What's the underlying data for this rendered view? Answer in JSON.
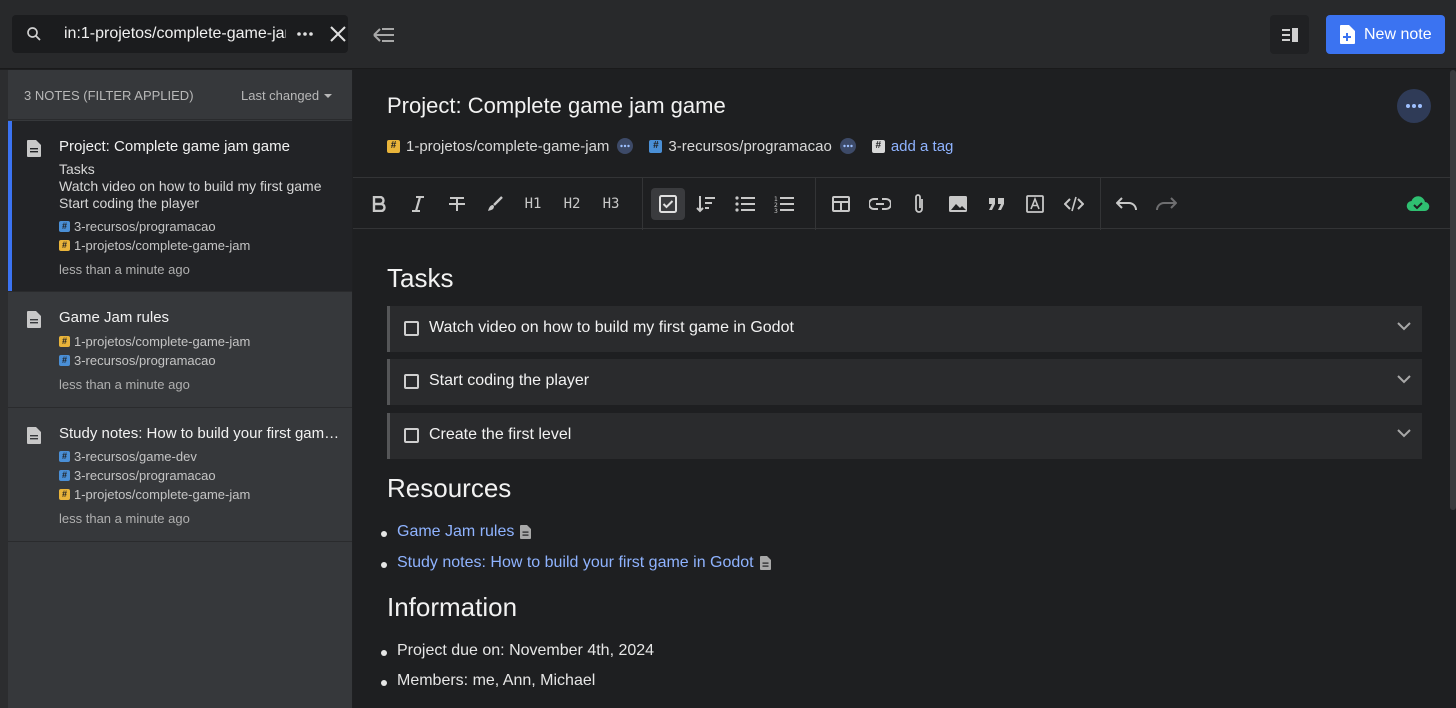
{
  "search": {
    "value": "in:1-projetos/complete-game-jam"
  },
  "header": {
    "new_note_label": "New note"
  },
  "list": {
    "count_label": "3 NOTES (FILTER APPLIED)",
    "sort_label": "Last changed",
    "notes": [
      {
        "title": "Project: Complete game jam game",
        "preview": [
          "Tasks",
          "Watch video on how to build my first game",
          "Start coding the player"
        ],
        "tags": [
          {
            "name": "3-recursos/programacao",
            "color": "#4a8fd6"
          },
          {
            "name": "1-projetos/complete-game-jam",
            "color": "#e9b43a"
          }
        ],
        "time": "less than a minute ago"
      },
      {
        "title": "Game Jam rules",
        "tags": [
          {
            "name": "1-projetos/complete-game-jam",
            "color": "#e9b43a"
          },
          {
            "name": "3-recursos/programacao",
            "color": "#4a8fd6"
          }
        ],
        "time": "less than a minute ago"
      },
      {
        "title": "Study notes: How to build your first game in Godot",
        "tags": [
          {
            "name": "3-recursos/game-dev",
            "color": "#4a8fd6"
          },
          {
            "name": "3-recursos/programacao",
            "color": "#4a8fd6"
          },
          {
            "name": "1-projetos/complete-game-jam",
            "color": "#e9b43a"
          }
        ],
        "time": "less than a minute ago"
      }
    ]
  },
  "note": {
    "title": "Project: Complete game jam game",
    "tags": [
      "1-projetos/complete-game-jam",
      "3-recursos/programacao"
    ],
    "add_tag_label": "add a tag",
    "toolbar": {
      "h1": "H1",
      "h2": "H2",
      "h3": "H3"
    },
    "sections": {
      "tasks_heading": "Tasks",
      "tasks": [
        "Watch video on how to build my first game in Godot",
        "Start coding the player",
        "Create the first level"
      ],
      "resources_heading": "Resources",
      "resources": [
        "Game Jam rules",
        "Study notes: How to build your first game in Godot"
      ],
      "information_heading": "Information",
      "information": [
        "Project due on: November 4th, 2024",
        "Members: me, Ann, Michael"
      ]
    }
  },
  "colors": {
    "accent": "#3b73f1",
    "link": "#8fb3ff",
    "sync": "#2fbf71"
  }
}
